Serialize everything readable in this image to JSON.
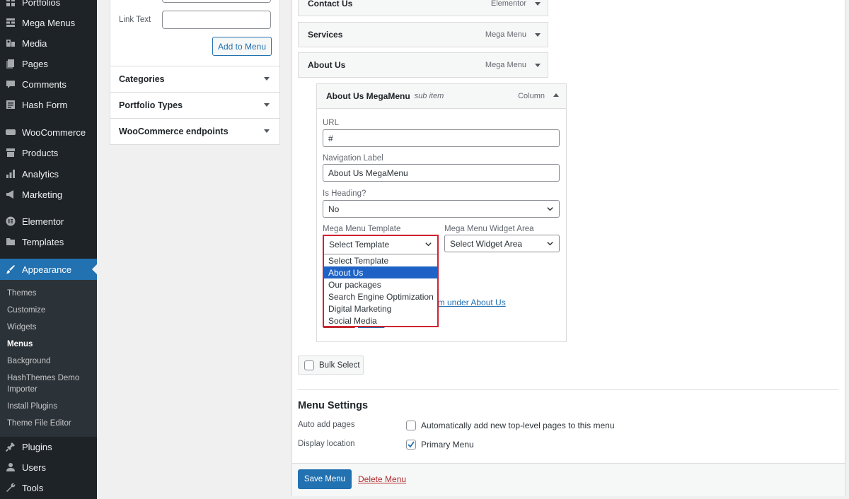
{
  "sidebar": {
    "items": [
      {
        "label": "Portfolios",
        "icon": "grid-icon"
      },
      {
        "label": "Mega Menus",
        "icon": "grid-icon"
      },
      {
        "label": "Media",
        "icon": "media-icon"
      },
      {
        "label": "Pages",
        "icon": "pages-icon"
      },
      {
        "label": "Comments",
        "icon": "comment-icon"
      },
      {
        "label": "Hash Form",
        "icon": "form-icon"
      },
      {
        "label": "WooCommerce",
        "icon": "woo-icon"
      },
      {
        "label": "Products",
        "icon": "archive-icon"
      },
      {
        "label": "Analytics",
        "icon": "bar-chart-icon"
      },
      {
        "label": "Marketing",
        "icon": "megaphone-icon"
      },
      {
        "label": "Elementor",
        "icon": "elementor-icon"
      },
      {
        "label": "Templates",
        "icon": "folder-icon"
      },
      {
        "label": "Appearance",
        "icon": "brush-icon"
      },
      {
        "label": "Plugins",
        "icon": "plug-icon"
      },
      {
        "label": "Users",
        "icon": "user-icon"
      },
      {
        "label": "Tools",
        "icon": "wrench-icon"
      }
    ],
    "submenu": [
      "Themes",
      "Customize",
      "Widgets",
      "Menus",
      "Background",
      "HashThemes Demo",
      "Importer",
      "Install Plugins",
      "Theme File Editor"
    ]
  },
  "left": {
    "link_text_label": "Link Text",
    "link_text_value": "",
    "add_to_menu": "Add to Menu",
    "accordions": [
      "Categories",
      "Portfolio Types",
      "WooCommerce endpoints"
    ]
  },
  "menu_items": [
    {
      "title": "Contact Us",
      "type": "Elementor"
    },
    {
      "title": "Services",
      "type": "Mega Menu"
    },
    {
      "title": "About Us",
      "type": "Mega Menu"
    }
  ],
  "sub_item": {
    "title": "About Us MegaMenu",
    "tag": "sub item",
    "type": "Column",
    "url_label": "URL",
    "url_value": "#",
    "nav_label_label": "Navigation Label",
    "nav_label_value": "About Us MegaMenu",
    "heading_label": "Is Heading?",
    "heading_value": "No",
    "template_label": "Mega Menu Template",
    "template_value": "Select Template",
    "widget_label": "Mega Menu Widget Area",
    "widget_value": "Select Widget Area",
    "template_options": [
      "Select Template",
      "About Us",
      "Our packages",
      "Search Engine Optimization",
      "Digital Marketing",
      "Social Media"
    ],
    "selected_option": "About Us",
    "move_link_partial": "om under About Us",
    "remove_partial": "Remove",
    "cancel_partial": "Cancel"
  },
  "bulk_select": "Bulk Select",
  "settings": {
    "title": "Menu Settings",
    "auto_add_label": "Auto add pages",
    "auto_add_option": "Automatically add new top-level pages to this menu",
    "auto_add_checked": false,
    "display_label": "Display location",
    "display_option": "Primary Menu",
    "display_checked": true
  },
  "footer": {
    "save": "Save Menu",
    "delete": "Delete Menu"
  },
  "colors": {
    "accent": "#2271b1",
    "highlight_border": "#d0222f",
    "sidebar_bg": "#1d2327"
  }
}
